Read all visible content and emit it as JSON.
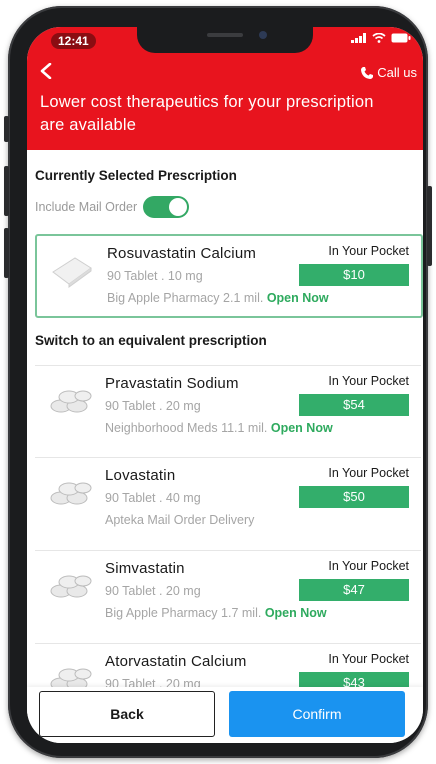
{
  "status_bar": {
    "time": "12:41"
  },
  "header": {
    "call_label": "Call us",
    "headline": "Lower cost therapeutics for your prescription are available"
  },
  "current_section": {
    "title": "Currently Selected Prescription",
    "mail_order_label": "Include Mail Order",
    "mail_order_enabled": true
  },
  "selected": {
    "name": "Rosuvastatin Calcium",
    "qty": "90 Tablet . 10 mg",
    "pharmacy": "Big Apple Pharmacy",
    "distance": "2.1 mil.",
    "status": "Open Now",
    "pocket_label": "In Your Pocket",
    "price": "$10"
  },
  "switch_section": {
    "title": "Switch to an equivalent prescription"
  },
  "alternatives": [
    {
      "name": "Pravastatin Sodium",
      "qty": "90 Tablet . 20 mg",
      "pharmacy": "Neighborhood Meds",
      "distance": "11.1 mil.",
      "status": "Open Now",
      "pocket_label": "In Your Pocket",
      "price": "$54"
    },
    {
      "name": "Lovastatin",
      "qty": "90 Tablet . 40 mg",
      "pharmacy": "Apteka Mail Order Delivery",
      "distance": "",
      "status": "",
      "pocket_label": "In Your Pocket",
      "price": "$50"
    },
    {
      "name": "Simvastatin",
      "qty": "90 Tablet . 20 mg",
      "pharmacy": "Big Apple Pharmacy",
      "distance": "1.7 mil.",
      "status": "Open Now",
      "pocket_label": "In Your Pocket",
      "price": "$47"
    },
    {
      "name": "Atorvastatin Calcium",
      "qty": "90 Tablet . 20 mg",
      "pharmacy": "",
      "distance": "",
      "status": "",
      "pocket_label": "In Your Pocket",
      "price": "$43"
    }
  ],
  "actions": {
    "back_label": "Back",
    "confirm_label": "Confirm"
  },
  "colors": {
    "brand_red": "#e8141e",
    "accent_green": "#33ae6b",
    "confirm_blue": "#1a93f0"
  },
  "icons": [
    "back-arrow-icon",
    "phone-icon",
    "signal-icon",
    "wifi-icon",
    "battery-icon",
    "pill-icon"
  ]
}
